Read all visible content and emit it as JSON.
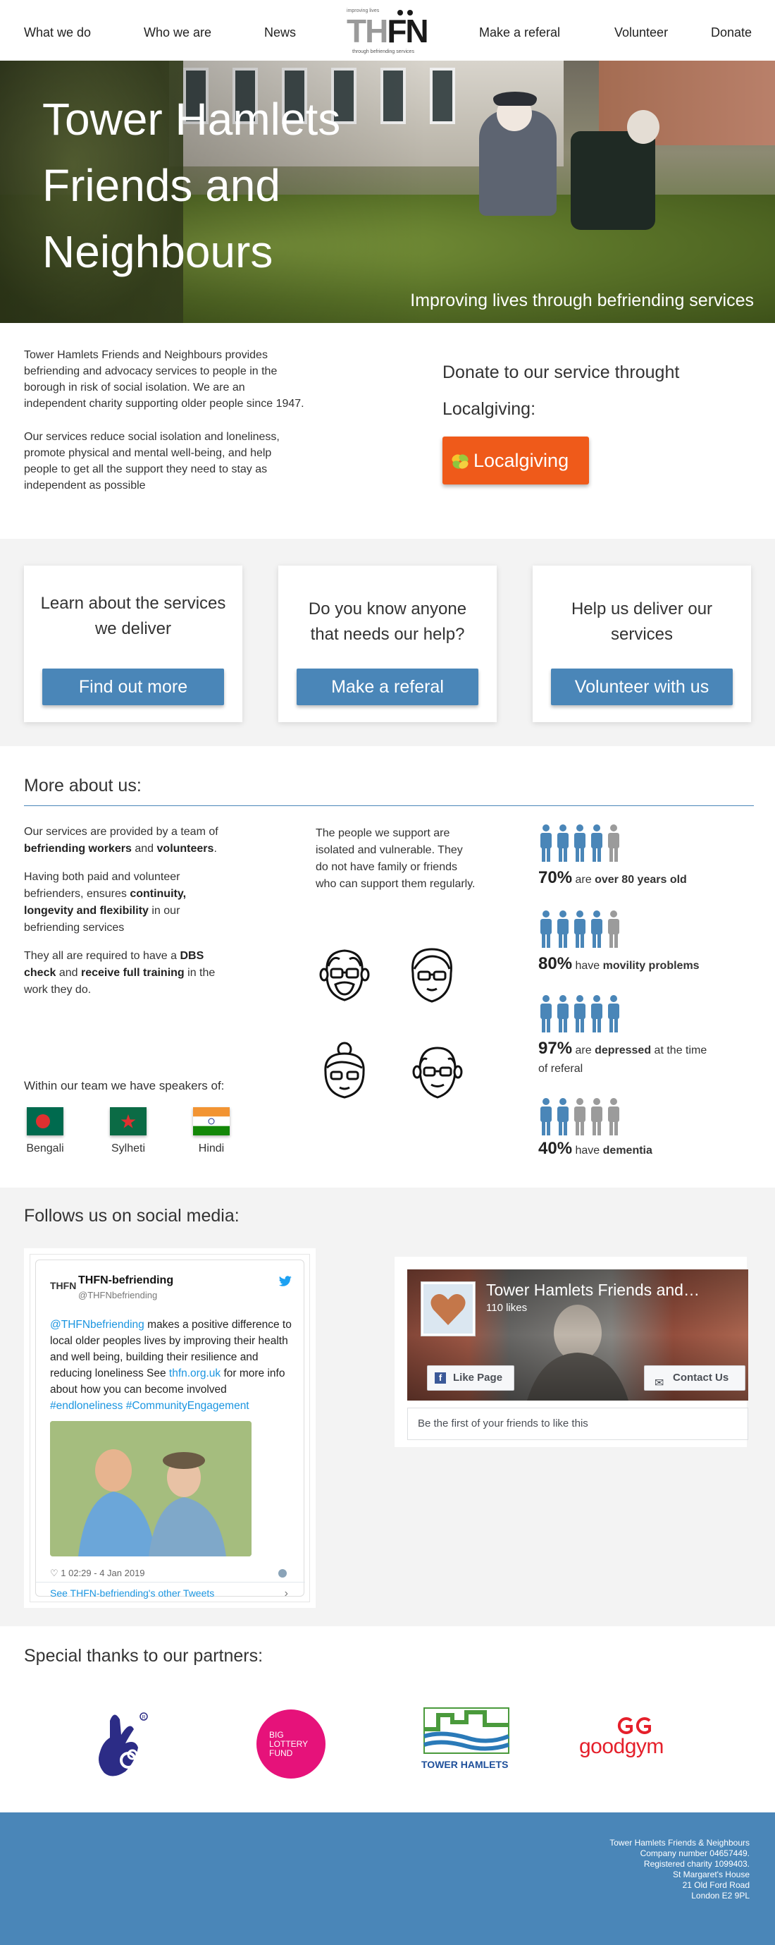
{
  "nav": {
    "items": [
      "What we do",
      "Who we are",
      "News",
      "Make a referal",
      "Volunteer",
      "Donate"
    ],
    "logo": {
      "top": "improving lives",
      "letters_left": "TH",
      "letters_right": "FN",
      "bottom": "through befriending services"
    }
  },
  "hero": {
    "title": "Tower Hamlets Friends and Neighbours",
    "tagline": "Improving lives through befriending services"
  },
  "intro": {
    "p1": "Tower Hamlets Friends and Neighbours provides befriending and advocacy services to people in the borough in risk of social isolation. We are an independent charity supporting older people since 1947.",
    "p2": "Our services reduce social isolation and loneliness, promote physical and mental well-being, and help people to get all the support they need to stay as independent as possible",
    "donate_text": "Donate to our service throught Localgiving:",
    "localgiving_label": "Localgiving"
  },
  "cards": [
    {
      "title": "Learn about the services we deliver",
      "button": "Find out more"
    },
    {
      "title": "Do you know anyone that needs our help?",
      "button": "Make a referal"
    },
    {
      "title": "Help us deliver our services",
      "button": "Volunteer with us"
    }
  ],
  "more": {
    "title": "More about us:",
    "team": {
      "p1_a": "Our services are provided by a team of ",
      "p1_b": "befriending workers",
      "p1_c": " and ",
      "p1_d": "volunteers",
      "p1_e": ".",
      "p2_a": "Having both paid and volunteer befrienders, ensures ",
      "p2_b": "continuity, longevity and flexibility",
      "p2_c": " in our befriending services",
      "p3_a": "They all are required to have a ",
      "p3_b": "DBS check",
      "p3_c": " and ",
      "p3_d": "receive full training",
      "p3_e": " in the work they do."
    },
    "support": "The people we support are isolated and vulnerable. They do not have family or friends who can support them regularly.",
    "stats": [
      {
        "pct": "70%",
        "pre": " are ",
        "bold": "over 80 years old",
        "post": "",
        "filled": 4
      },
      {
        "pct": "80%",
        "pre": " have ",
        "bold": "movility problems",
        "post": "",
        "filled": 4
      },
      {
        "pct": "97%",
        "pre": " are ",
        "bold": "depressed",
        "post": " at the time of referal",
        "filled": 5
      },
      {
        "pct": "40%",
        "pre": " have ",
        "bold": "dementia",
        "post": "",
        "filled": 2
      }
    ],
    "speakers_title": "Within our team we have speakers of:",
    "languages": [
      "Bengali",
      "Sylheti",
      "Hindi"
    ]
  },
  "social": {
    "title": "Follows us on social media:",
    "tweet": {
      "logo": "THFN",
      "name": "THFN-befriending",
      "handle": "@THFNbefriending",
      "mention": "@THFNbefriending",
      "body1": " makes a positive difference to local older peoples lives by improving their health and well being, building their resilience and reducing loneliness See ",
      "link": "thfn.org.uk",
      "body2": " for more info about how you can become involved ",
      "tags": "#endloneliness #CommunityEngagement",
      "meta": "♡ 1   02:29 - 4 Jan 2019",
      "more": "See THFN-befriending's other Tweets"
    },
    "facebook": {
      "name": "Tower Hamlets Friends and…",
      "likes": "110 likes",
      "like_btn": "Like Page",
      "contact_btn": "Contact Us",
      "first": "Be the first of your friends to like this"
    }
  },
  "partners": {
    "title": "Special thanks to our partners:",
    "big_lottery_1": "BIG",
    "big_lottery_2": "LOTTERY",
    "big_lottery_3": "FUND",
    "tower_hamlets": "TOWER HAMLETS",
    "goodgym": "goodgym"
  },
  "footer": {
    "lines": [
      "Tower Hamlets Friends & Neighbours",
      "Company number 04657449.",
      "Registered charity 1099403.",
      "St Margaret's House",
      "21 Old Ford Road",
      "London E2 9PL"
    ]
  },
  "colors": {
    "accent": "#4a86b8",
    "localgiving": "#ef5a1a",
    "figure_filled": "#4a86b8",
    "figure_empty": "#9b9b9b"
  }
}
